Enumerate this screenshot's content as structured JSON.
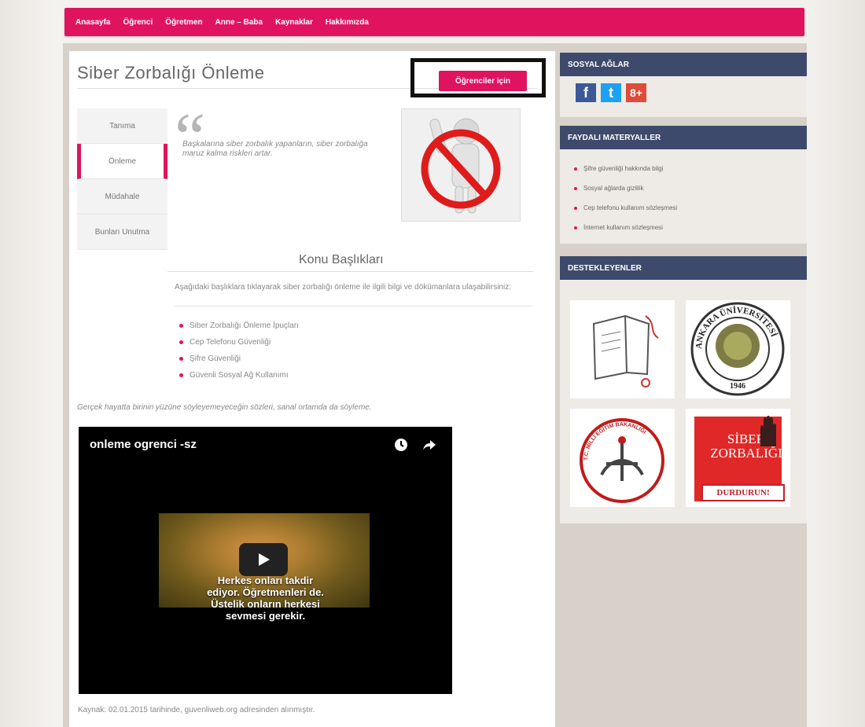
{
  "nav": {
    "items": [
      "Anasayfa",
      "Öğrenci",
      "Öğretmen",
      "Anne – Baba",
      "Kaynaklar",
      "Hakkımızda"
    ]
  },
  "page": {
    "title": "Siber Zorbalığı Önleme",
    "button_label": "Öğrenciler için"
  },
  "tabs": [
    "Tanıma",
    "Önleme",
    "Müdahale",
    "Bunları Unutma"
  ],
  "quote": {
    "text": "Başkalarına siber zorbalık yapanların, siber zorbalığa maruz kalma riskleri artar."
  },
  "konu": {
    "title": "Konu Başlıkları",
    "description": "Aşağıdaki başlıklara tıklayarak siber zorbalığı önleme ile ilgili bilgi ve dökümanlara ulaşabilirsiniz:",
    "items": [
      "Siber Zorbalığı Önleme İpuçları",
      "Cep Telefonu Güvenliği",
      "Şifre Güvenliği",
      "Güvenli Sosyal Ağ Kullanımı"
    ]
  },
  "note": "Gerçek hayatta birinin yüzüne söyleyemeyeceğin sözleri, sanal ortamda da söyleme.",
  "video": {
    "title": "onleme ogrenci -sz",
    "subtitle_lines": [
      "Herkes onları takdir",
      "ediyor. Öğretmenleri de.",
      "Üstelik onların herkesi",
      "sevmesi gerekir."
    ]
  },
  "source": "Kaynak: 02.01.2015 tarihinde, guvenliweb.org adresinden alınmıştır.",
  "sidebar": {
    "social": {
      "heading": "SOSYAL AĞLAR",
      "icons": [
        "facebook-icon",
        "twitter-icon",
        "google-plus-icon"
      ],
      "labels": [
        "f",
        "t",
        "8+"
      ]
    },
    "materials": {
      "heading": "FAYDALI MATERYALLER",
      "items": [
        "Şifre güvenliği hakkında bilgi",
        "Sosyal ağlarda gizlilik",
        "Cep telefonu kullanım sözleşmesi",
        "İnternet kullanım sözleşmesi"
      ]
    },
    "supporters": {
      "heading": "DESTEKLEYENLER",
      "ankara_text": "ANKARA ÜNİVERSİTESİ",
      "ankara_year": "1946",
      "meb_text": "T.C. MİLLİ EĞİTİM BAKANLIĞI",
      "sz_line1": "SİBER",
      "sz_line2": "ZORBALIĞI",
      "sz_button": "DURDURUN!"
    }
  },
  "colors": {
    "accent": "#e0135f",
    "sidebar_header": "#3e4a6b"
  }
}
